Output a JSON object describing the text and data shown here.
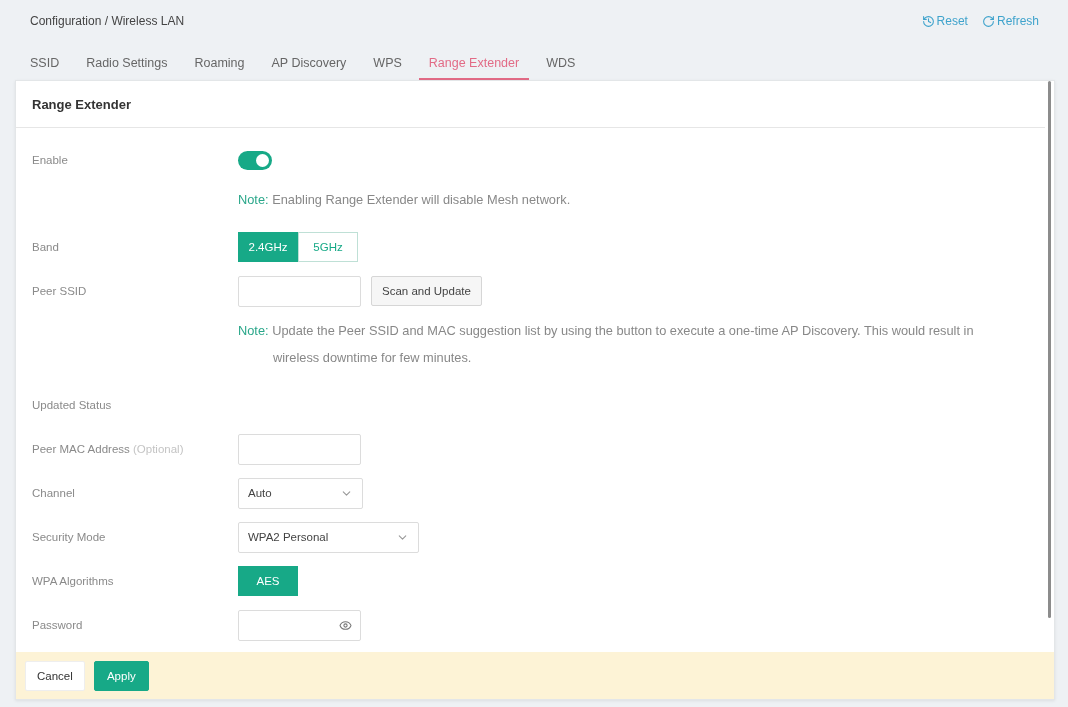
{
  "breadcrumb": "Configuration / Wireless LAN",
  "actions": [
    {
      "kind": "reset",
      "label": "Reset"
    },
    {
      "kind": "refresh",
      "label": "Refresh"
    }
  ],
  "tabs": [
    {
      "label": "SSID",
      "selected": false
    },
    {
      "label": "Radio Settings",
      "selected": false
    },
    {
      "label": "Roaming",
      "selected": false
    },
    {
      "label": "AP Discovery",
      "selected": false
    },
    {
      "label": "WPS",
      "selected": false
    },
    {
      "label": "Range Extender",
      "selected": true
    },
    {
      "label": "WDS",
      "selected": false
    }
  ],
  "panel": {
    "title": "Range Extender",
    "rows": [
      {
        "kind": "toggle",
        "label": "Enable",
        "on": true
      },
      {
        "kind": "note",
        "prefix": "Note:",
        "text": "Enabling Range Extender will disable Mesh network."
      },
      {
        "kind": "segmented",
        "label": "Band",
        "options": [
          {
            "label": "2.4GHz",
            "selected": true
          },
          {
            "label": "5GHz",
            "selected": false
          }
        ]
      },
      {
        "kind": "input-button",
        "label": "Peer SSID",
        "button": "Scan and Update"
      },
      {
        "kind": "note",
        "prefix": "Note:",
        "text": "Update the Peer SSID and MAC suggestion list by using the button to execute a one-time AP Discovery. This would result in wireless downtime for few minutes."
      },
      {
        "kind": "heading",
        "label": "Updated Status"
      },
      {
        "kind": "input",
        "label": "Peer MAC Address",
        "hint": "(Optional)"
      },
      {
        "kind": "select",
        "label": "Channel",
        "value": "Auto"
      },
      {
        "kind": "select",
        "label": "Security Mode",
        "value": "WPA2 Personal"
      },
      {
        "kind": "segmented",
        "label": "WPA Algorithms",
        "options": [
          {
            "label": "AES",
            "selected": true
          }
        ]
      },
      {
        "kind": "password",
        "label": "Password"
      }
    ]
  },
  "footer": {
    "buttons": [
      {
        "kind": "secondary",
        "label": "Cancel"
      },
      {
        "kind": "primary",
        "label": "Apply"
      }
    ]
  }
}
